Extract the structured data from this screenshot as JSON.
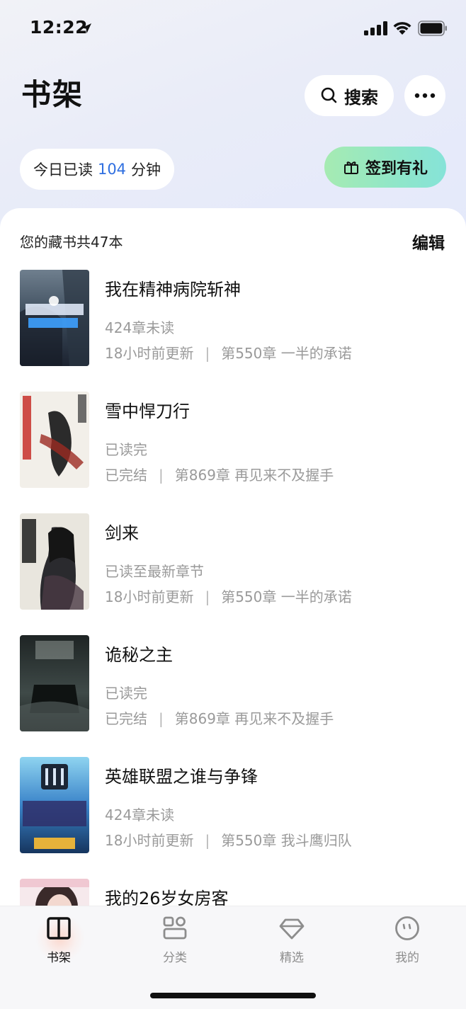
{
  "status_bar": {
    "time": "12:22"
  },
  "header": {
    "title": "书架",
    "search_label": "搜索"
  },
  "reading_today": {
    "prefix": "今日已读",
    "minutes": "104",
    "suffix": "分钟"
  },
  "signin": {
    "label": "签到有礼"
  },
  "shelf": {
    "count_text": "您的藏书共47本",
    "edit_label": "编辑"
  },
  "books": [
    {
      "title": "我在精神病院斩神",
      "status": "424章未读",
      "updated": "18小时前更新",
      "chapter": "第550章 一半的承诺"
    },
    {
      "title": "雪中悍刀行",
      "status": "已读完",
      "updated": "已完结",
      "chapter": "第869章 再见来不及握手"
    },
    {
      "title": "剑来",
      "status": "已读至最新章节",
      "updated": "18小时前更新",
      "chapter": "第550章 一半的承诺"
    },
    {
      "title": "诡秘之主",
      "status": "已读完",
      "updated": "已完结",
      "chapter": "第869章 再见来不及握手"
    },
    {
      "title": "英雄联盟之谁与争锋",
      "status": "424章未读",
      "updated": "18小时前更新",
      "chapter": "第550章 我斗鹰归队"
    },
    {
      "title": "我的26岁女房客",
      "status": "",
      "updated": "",
      "chapter": ""
    }
  ],
  "tabbar": {
    "tabs": [
      {
        "label": "书架",
        "icon": "bookshelf-icon",
        "active": true
      },
      {
        "label": "分类",
        "icon": "category-icon",
        "active": false
      },
      {
        "label": "精选",
        "icon": "diamond-icon",
        "active": false
      },
      {
        "label": "我的",
        "icon": "profile-face-icon",
        "active": false
      }
    ]
  },
  "colors": {
    "accent_blue": "#2f6fe0",
    "signin_gradient_start": "#a6ebb2",
    "signin_gradient_end": "#86e3d8",
    "muted_text": "#9a9a9a"
  }
}
